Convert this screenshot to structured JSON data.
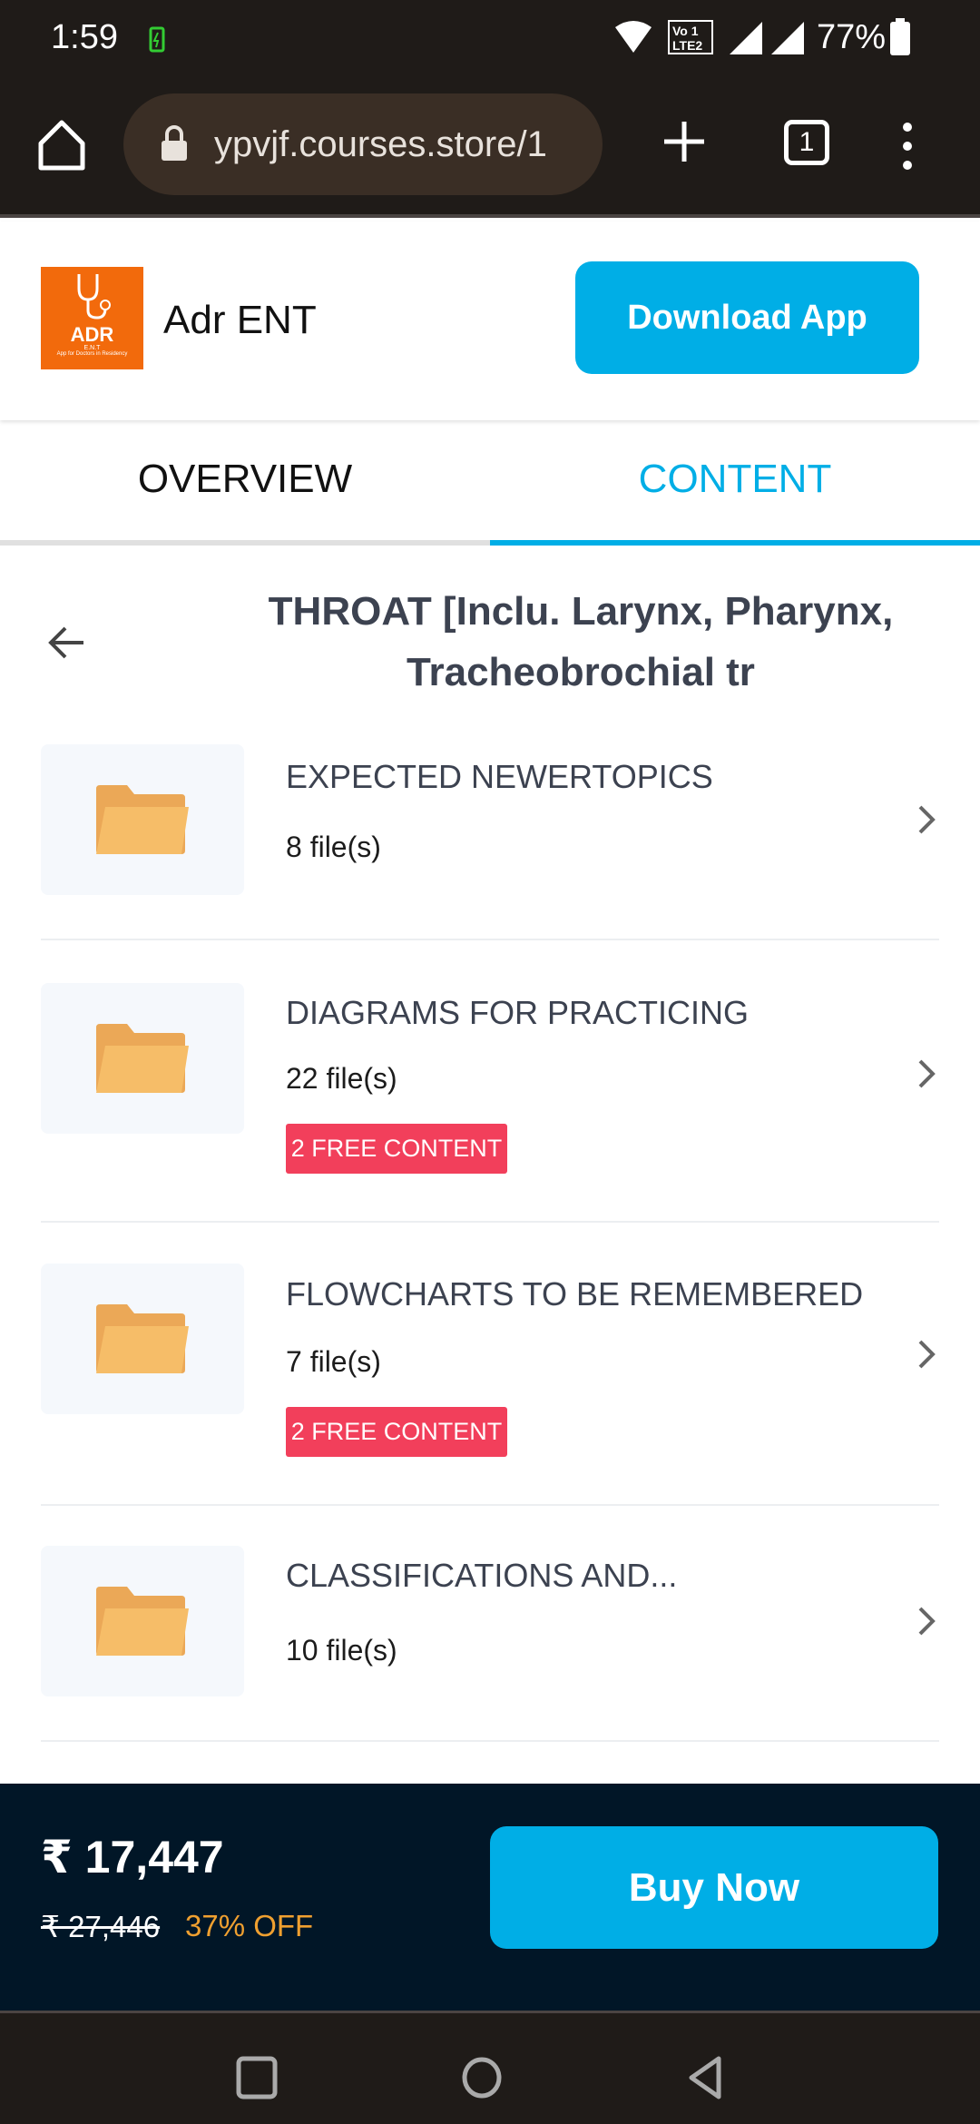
{
  "status_bar": {
    "time": "1:59",
    "battery": "77%"
  },
  "browser": {
    "url": "ypvjf.courses.store/1",
    "tab_count": "1"
  },
  "header": {
    "app_name": "Adr ENT",
    "logo_text": "ADR",
    "logo_sub": "E.N.T",
    "logo_tagline": "App for Doctors in Residency",
    "download_label": "Download App"
  },
  "tabs": [
    {
      "label": "OVERVIEW",
      "active": false
    },
    {
      "label": "CONTENT",
      "active": true
    }
  ],
  "section": {
    "title": "THROAT [Inclu. Larynx, Pharynx, Tracheobrochial tr"
  },
  "items": [
    {
      "title": "EXPECTED NEWERTOPICS",
      "files": "8 file(s)",
      "badge": null
    },
    {
      "title": "DIAGRAMS FOR PRACTICING",
      "files": "22 file(s)",
      "badge": "2 FREE CONTENT"
    },
    {
      "title": "FLOWCHARTS TO BE REMEMBERED",
      "files": "7 file(s)",
      "badge": "2 FREE CONTENT"
    },
    {
      "title": "CLASSIFICATIONS AND...",
      "files": "10 file(s)",
      "badge": null
    }
  ],
  "footer": {
    "price": "₹ 17,447",
    "original_price": "₹ 27,446",
    "discount": "37% OFF",
    "buy_label": "Buy Now"
  },
  "colors": {
    "accent": "#00aee6",
    "badge": "#f23f5b",
    "discount": "#f0a030",
    "footer_bg": "#011627",
    "folder": "#f4b860"
  }
}
